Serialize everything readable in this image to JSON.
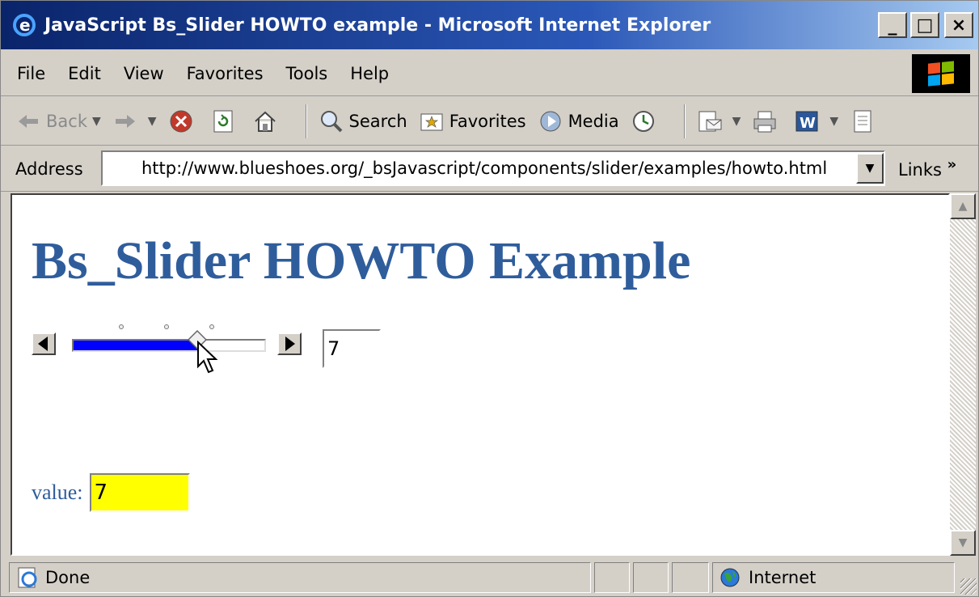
{
  "window": {
    "title": "JavaScript Bs_Slider HOWTO example - Microsoft Internet Explorer",
    "controls": [
      "_",
      "□",
      "×"
    ]
  },
  "menubar": {
    "items": [
      "File",
      "Edit",
      "View",
      "Favorites",
      "Tools",
      "Help"
    ]
  },
  "toolbar": {
    "back": "Back",
    "search": "Search",
    "favorites": "Favorites",
    "media": "Media"
  },
  "addressbar": {
    "label": "Address",
    "url": "http://www.blueshoes.org/_bsJavascript/components/slider/examples/howto.html",
    "links": "Links",
    "links_chevron": "»"
  },
  "page": {
    "title": "Bs_Slider HOWTO Example",
    "slider": {
      "value_text": "7",
      "fraction": 0.65
    },
    "value_label": "value:",
    "value_text": "7",
    "colors": {
      "title": "#2f5d9c",
      "slider_fill": "#0000ff",
      "value_bg": "#ffff00"
    }
  },
  "statusbar": {
    "status": "Done",
    "zone": "Internet"
  }
}
